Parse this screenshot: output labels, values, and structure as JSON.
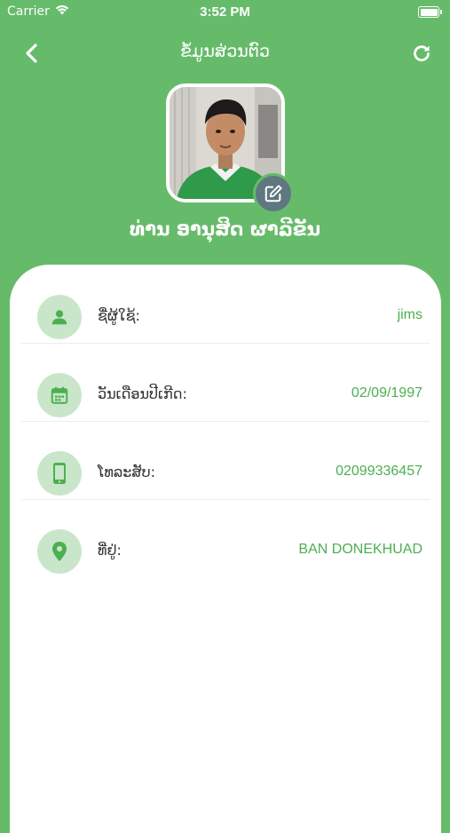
{
  "status_bar": {
    "carrier": "Carrier",
    "time": "3:52 PM"
  },
  "nav": {
    "title": "ຂໍ້ມູນສ່ວນຕົວ",
    "back_icon": "chevron-left-icon",
    "refresh_icon": "refresh-icon"
  },
  "profile": {
    "full_name": "ທ່ານ ອານຸສິດ  ຜາລີຂັນ",
    "edit_icon": "edit-icon"
  },
  "info_rows": [
    {
      "icon": "person-icon",
      "label": "ຊື່ຜູ້ໃຊ້:",
      "value": "jims"
    },
    {
      "icon": "calendar-icon",
      "label": "ວັນເດືອນປີເກີດ:",
      "value": "02/09/1997"
    },
    {
      "icon": "phone-icon",
      "label": "ໂທລະສັບ:",
      "value": "02099336457"
    },
    {
      "icon": "location-pin-icon",
      "label": "ທີ່ຢູ່:",
      "value": "BAN DONEKHUAD"
    }
  ],
  "colors": {
    "primary": "#66bb6a",
    "accent_text": "#4caf50",
    "icon_bg": "#c9e6ca",
    "edit_badge": "#5f7780"
  }
}
